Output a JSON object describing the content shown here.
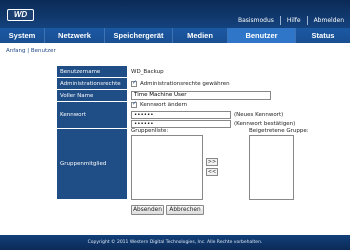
{
  "header": {
    "logo_text": "WD",
    "links": [
      "Basismodus",
      "Hilfe",
      "Abmelden"
    ]
  },
  "nav": {
    "tabs": [
      "System",
      "Netzwerk",
      "Speichergerät",
      "Medien",
      "Benutzer",
      "Status"
    ],
    "active": "Benutzer"
  },
  "breadcrumb": "Anfang | Benutzer",
  "form": {
    "benutzername": {
      "label": "Benutzername",
      "value": "WD_Backup"
    },
    "admin": {
      "label": "Administrationsrechte",
      "checkbox_label": "Administrationsrechte gewähren",
      "checked": true
    },
    "voller_name": {
      "label": "Voller Name",
      "value": "Time Machine User"
    },
    "kennwort": {
      "label": "Kennwort",
      "checkbox_label": "Kennwort ändern",
      "checked": true,
      "new_value": "••••••",
      "new_hint": "(Neues Kennwort)",
      "confirm_value": "••••••",
      "confirm_hint": "(Kennwort bestätigen)"
    },
    "gruppen": {
      "label": "Gruppenmitglied",
      "list_left_label": "Gruppenliste:",
      "list_right_label": "Beigetretene Gruppe:",
      "add_label": ">>",
      "remove_label": "<<"
    }
  },
  "buttons": {
    "submit": "Absenden",
    "cancel": "Abbrechen"
  },
  "footer": "Copyright © 2011 Western Digital Technologies, Inc. Alle Rechte vorbehalten.",
  "colors": {
    "header": "#0b2a56",
    "nav": "#1b58a3",
    "nav_active": "#2f76c8",
    "label_bg": "#1f4d86"
  }
}
